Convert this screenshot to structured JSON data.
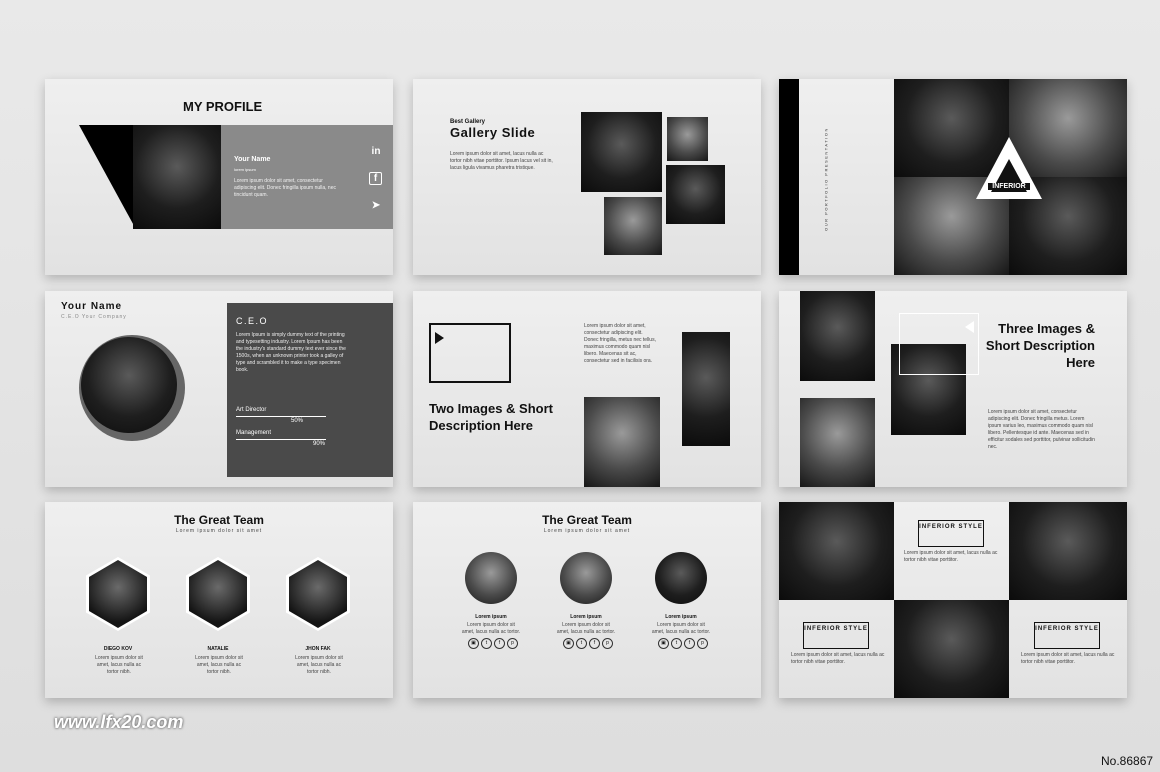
{
  "slide1": {
    "title": "MY PROFILE",
    "name": "Your Name",
    "sub": "lorem ipsum",
    "text": "Lorem ipsum dolor sit amet, consectetur adipiscing elit. Donec fringilla ipsum nulla, nec tincidunt quam."
  },
  "slide2": {
    "kicker": "Best Gallery",
    "title": "Gallery Slide",
    "text": "Lorem ipsum dolor sit amet, lacus nulla ac tortor nibh vitae porttitor. Ipsum lacus vel sit in, lacus ligula vivamus pharetra tristique."
  },
  "slide3": {
    "vertical": "OUR PORTFOLIO PRESENTATION",
    "badge": "INFERIOR"
  },
  "slide4": {
    "name": "Your Name",
    "company": "C.E.O Your Company",
    "role": "C.E.O",
    "bio": "Lorem Ipsum is simply dummy text of the printing and typesetting industry. Lorem Ipsum has been the industry's standard dummy text ever since the 1500s, when an unknown printer took a galley of type and scrambled it to make a type specimen book.",
    "skill1": "Art Director",
    "skill1_val": "50%",
    "skill2": "Management",
    "skill2_val": "90%"
  },
  "slide5": {
    "title": "Two Images & Short Description Here",
    "text": "Lorem ipsum dolor sit amet, consectetur adipiscing elit. Donec fringilla, metus nec tellus, maximus commodo quam nisl libero. Maecenas sit ac, consectetur sed in facilisis ora."
  },
  "slide6": {
    "title": "Three Images & Short Description Here",
    "text": "Lorem ipsum dolor sit amet, consectetur adipiscing elit. Donec fringilla metus. Lorem ipsum varius leo, maximus commodo quam nisl libero. Pellentesque id ante. Maecenas sed in efficitur sodales sed porttitor, pulvinar sollicitudin nec."
  },
  "slide7": {
    "title": "The Great Team",
    "sub": "Lorem ipsum dolor sit amet",
    "members": [
      {
        "name": "DIEGO KOV",
        "text": "Lorem ipsum dolor sit amet, lacus nulla ac tortor nibh."
      },
      {
        "name": "NATALIE",
        "text": "Lorem ipsum dolor sit amet, lacus nulla ac tortor nibh."
      },
      {
        "name": "JHON FAK",
        "text": "Lorem ipsum dolor sit amet, lacus nulla ac tortor nibh."
      }
    ]
  },
  "slide8": {
    "title": "The Great Team",
    "sub": "Lorem ipsum dolor sit amet",
    "members": [
      {
        "name": "Lorem ipsum",
        "text": "Lorem ipsum dolor sit amet, lacus nulla ac tortor."
      },
      {
        "name": "Lorem ipsum",
        "text": "Lorem ipsum dolor sit amet, lacus nulla ac tortor."
      },
      {
        "name": "Lorem ipsum",
        "text": "Lorem ipsum dolor sit amet, lacus nulla ac tortor."
      }
    ]
  },
  "slide9": {
    "label1": "INFERIOR STYLE",
    "label2": "INFERIOR STYLE",
    "label3": "INFERIOR STYLE",
    "text": "Lorem ipsum dolor sit amet, lacus nulla ac tortor nibh vitae porttitor."
  },
  "watermark": "www.lfx20.com",
  "product_no": "No.86867"
}
